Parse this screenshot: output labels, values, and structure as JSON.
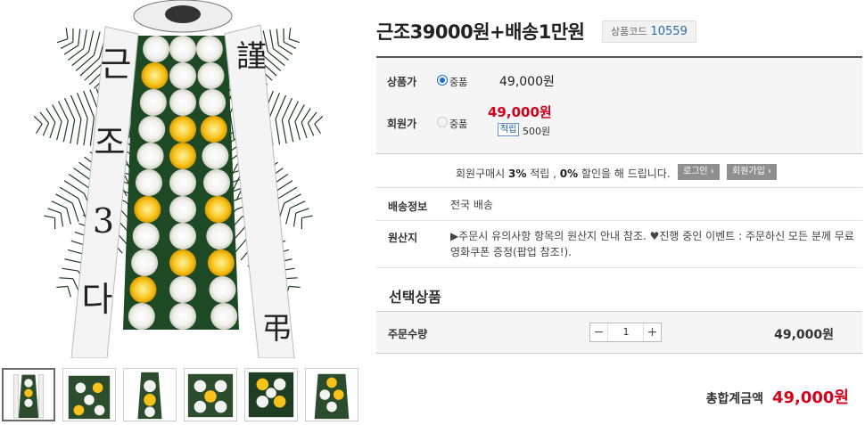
{
  "product": {
    "title": "근조39000원+배송1만원",
    "code_label": "상품코드",
    "code_value": "10559"
  },
  "pricing": {
    "list_label": "상품가",
    "list_option": "중품",
    "list_price": "49,000원",
    "member_label": "회원가",
    "member_option": "중품",
    "member_price": "49,000원",
    "points_tag": "적립",
    "points_value": "500원"
  },
  "member_benefit": {
    "text_prefix": "회원구매시 ",
    "rate": "3%",
    "text_mid1": " 적립 , ",
    "discount": "0%",
    "text_suffix": " 할인을 해 드립니다.",
    "login_button": "로그인 ›",
    "join_button": "회원가입 ›"
  },
  "shipping": {
    "label": "배송정보",
    "value": "전국 배송"
  },
  "origin": {
    "label": "원산지",
    "value": "▶주문시 유의사항 항목의 원산지 안내 참조. ♥진행 중인 이벤트 : 주문하신 모든 분께 무료 영화쿠폰 증정(팝업 참조!)."
  },
  "selection": {
    "title": "선택상품",
    "qty_label": "주문수량",
    "qty_value": "1",
    "minus": "−",
    "plus": "+",
    "price": "49,000원"
  },
  "total": {
    "label": "총합계금액",
    "value": "49,000원"
  },
  "ribbon": {
    "left_text": [
      "근",
      "조",
      "3",
      "다"
    ],
    "right_text": [
      "謹",
      "弔"
    ]
  },
  "colors": {
    "accent_red": "#d7001b",
    "radio_blue": "#1a6fd8",
    "code_blue": "#2b6aa5"
  }
}
